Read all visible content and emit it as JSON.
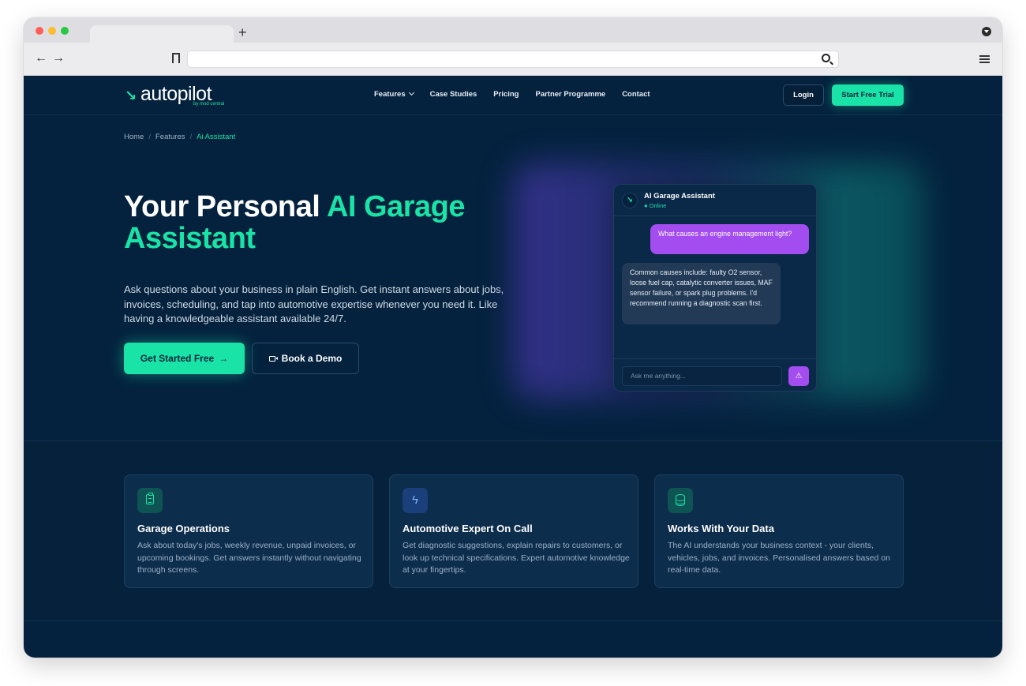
{
  "browser": {
    "back_icon": "arrow-left-icon",
    "forward_icon": "arrow-right-icon",
    "new_tab_label": "+",
    "url": ""
  },
  "nav": {
    "logo_text": "autopilot",
    "logo_sub": "by mod central",
    "menu": [
      "Features",
      "Case Studies",
      "Pricing",
      "Partner Programme",
      "Contact"
    ],
    "login_label": "Login",
    "trial_label": "Start Free Trial"
  },
  "breadcrumb": {
    "items": [
      "Home",
      "Features",
      "Ai Assistant"
    ],
    "separator": "/"
  },
  "hero": {
    "title_plain": "Your Personal ",
    "title_accent": "AI Garage Assistant",
    "lead": "Ask questions about your business in plain English. Get instant answers about jobs, invoices, scheduling, and tap into automotive expertise whenever you need it. Like having a knowledgeable assistant available 24/7.",
    "primary_label": "Get Started Free",
    "primary_arrow": "→",
    "secondary_label": "Book a Demo"
  },
  "chat": {
    "name": "AI Garage Assistant",
    "status": "● Online",
    "user_message": "What causes an engine management light?",
    "bot_message": "Common causes include: faulty O2 sensor, loose fuel cap, catalytic converter issues, MAF sensor failure, or spark plug problems. I'd recommend running a diagnostic scan first.",
    "input_placeholder": "Ask me anything...",
    "send_glyph": "⚠"
  },
  "features": [
    {
      "icon": "clipboard-icon",
      "title": "Garage Operations",
      "desc": "Ask about today's jobs, weekly revenue, unpaid invoices, or upcoming bookings. Get answers instantly without navigating through screens."
    },
    {
      "icon": "lightning-icon",
      "title": "Automotive Expert On Call",
      "desc": "Get diagnostic suggestions, explain repairs to customers, or look up technical specifications. Expert automotive knowledge at your fingertips."
    },
    {
      "icon": "database-icon",
      "title": "Works With Your Data",
      "desc": "The AI understands your business context - your clients, vehicles, jobs, and invoices. Personalised answers based on real-time data."
    }
  ],
  "colors": {
    "accent": "#19e3a6",
    "background": "#04223e",
    "purple": "#a34df0"
  }
}
